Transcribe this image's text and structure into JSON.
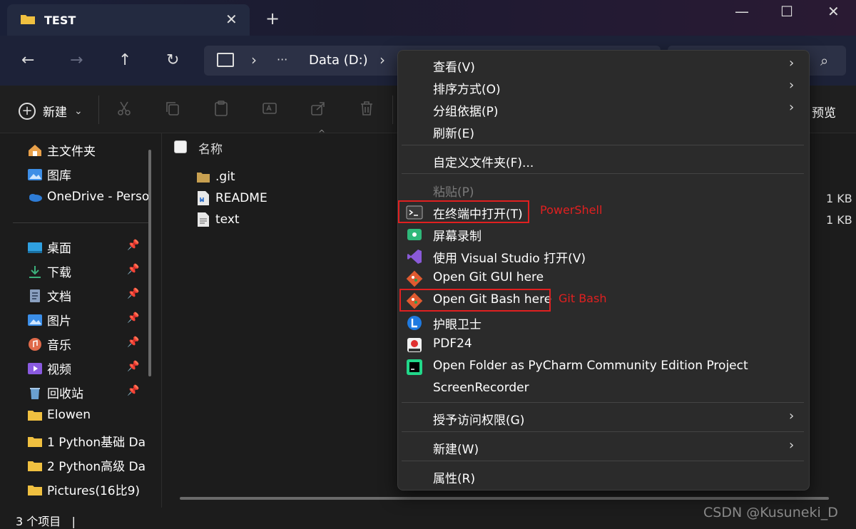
{
  "window": {
    "tab_title": "TEST",
    "tab_close": "✕",
    "new_tab": "+",
    "minimize": "—",
    "maximize": "☐",
    "close": "✕"
  },
  "nav": {
    "back": "←",
    "forward": "→",
    "up": "↑",
    "refresh": "↻",
    "breadcrumb_sep": "›",
    "more": "···",
    "location": "Data (D:)",
    "search_icon": "⌕"
  },
  "toolbar": {
    "new_label": "新建",
    "new_chevron": "⌄",
    "preview_label": "预览",
    "icons": [
      "scissors-icon",
      "copy-icon",
      "paste-icon",
      "rename-icon",
      "share-icon",
      "delete-icon"
    ]
  },
  "sidebar": {
    "items": [
      {
        "label": "主文件夹",
        "icon": "home-icon",
        "color": "#e8a04a"
      },
      {
        "label": "图库",
        "icon": "gallery-icon",
        "color": "#3d8ee6"
      },
      {
        "label": "OneDrive - Perso",
        "icon": "onedrive-icon",
        "color": "#2e7cd6"
      }
    ],
    "pinned": [
      {
        "label": "桌面",
        "icon": "desktop-icon",
        "color": "#2fa0e0"
      },
      {
        "label": "下载",
        "icon": "download-icon",
        "color": "#3bb07b"
      },
      {
        "label": "文档",
        "icon": "document-icon",
        "color": "#8aa0c0"
      },
      {
        "label": "图片",
        "icon": "pictures-icon",
        "color": "#3b8ee8"
      },
      {
        "label": "音乐",
        "icon": "music-icon",
        "color": "#e06a4a"
      },
      {
        "label": "视频",
        "icon": "video-icon",
        "color": "#8a5ae0"
      },
      {
        "label": "回收站",
        "icon": "recycle-bin-icon",
        "color": "#6aa0d0"
      }
    ],
    "folders": [
      {
        "label": "Elowen",
        "icon": "folder-icon",
        "color": "#f0c040"
      },
      {
        "label": "1 Python基础 Da",
        "icon": "folder-icon",
        "color": "#f0c040"
      },
      {
        "label": "2 Python高级 Da",
        "icon": "folder-icon",
        "color": "#f0c040"
      },
      {
        "label": "Pictures(16比9)",
        "icon": "folder-icon",
        "color": "#f0c040"
      }
    ],
    "pin_glyph": "📌"
  },
  "content": {
    "column_name": "名称",
    "sort_hint": "^",
    "files": [
      {
        "name": ".git",
        "icon": "folder-icon",
        "size": ""
      },
      {
        "name": "README",
        "icon": "markdown-file-icon",
        "size": "1 KB"
      },
      {
        "name": "text",
        "icon": "text-file-icon",
        "size": "1 KB"
      }
    ]
  },
  "status": {
    "items_count": "3 个项目",
    "cursor": "|"
  },
  "watermark": "CSDN @Kusuneki_D",
  "context_menu": {
    "items": [
      {
        "label": "查看(V)",
        "submenu": true
      },
      {
        "label": "排序方式(O)",
        "submenu": true
      },
      {
        "label": "分组依据(P)",
        "submenu": true
      },
      {
        "label": "刷新(E)"
      },
      {
        "label": "自定义文件夹(F)..."
      },
      {
        "label": "粘贴(P)",
        "disabled": true
      },
      {
        "label": "在终端中打开(T)",
        "icon": "terminal-icon"
      },
      {
        "label": "屏幕录制",
        "icon": "screen-record-icon"
      },
      {
        "label": "使用 Visual Studio 打开(V)",
        "icon": "visual-studio-icon"
      },
      {
        "label": "Open Git GUI here",
        "icon": "git-gui-icon"
      },
      {
        "label": "Open Git Bash here",
        "icon": "git-bash-icon"
      },
      {
        "label": "护眼卫士",
        "icon": "eye-guard-icon"
      },
      {
        "label": "PDF24",
        "icon": "pdf24-icon"
      },
      {
        "label": "Open Folder as PyCharm Community Edition Project",
        "icon": "pycharm-icon"
      },
      {
        "label": "ScreenRecorder"
      },
      {
        "label": "授予访问权限(G)",
        "submenu": true
      },
      {
        "label": "新建(W)",
        "submenu": true
      },
      {
        "label": "属性(R)"
      }
    ],
    "chevron": "›"
  },
  "annotations": {
    "terminal": "PowerShell",
    "git_bash": "Git Bash",
    "highlight_color": "#e02020"
  }
}
